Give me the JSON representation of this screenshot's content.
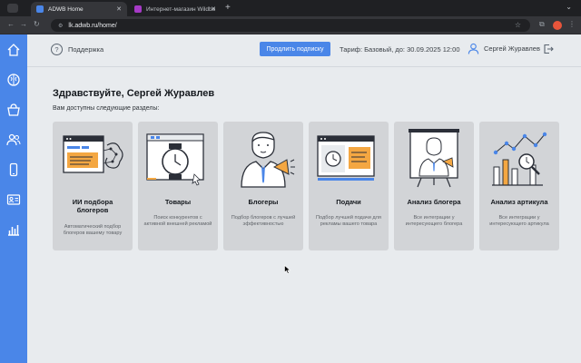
{
  "browser": {
    "tabs": [
      {
        "title": "ADWB Home",
        "active": true
      },
      {
        "title": "Интернет-магазин Wildber",
        "active": false
      }
    ],
    "url": "lk.adwb.ru/home/"
  },
  "sidebar": {
    "items": [
      {
        "icon": "home-icon"
      },
      {
        "icon": "brain-icon"
      },
      {
        "icon": "basket-icon"
      },
      {
        "icon": "users-icon"
      },
      {
        "icon": "phone-icon"
      },
      {
        "icon": "id-card-icon"
      },
      {
        "icon": "bar-chart-icon"
      }
    ]
  },
  "header": {
    "support_label": "Поддержка",
    "renew_label": "Продлить подписку",
    "tariff_text": "Тариф: Базовый, до: 30.09.2025 12:00",
    "user_name": "Сергей Журавлев"
  },
  "main": {
    "greeting": "Здравствуйте, Сергей Журавлев",
    "subtitle": "Вам доступны следующие разделы:",
    "cards": [
      {
        "title": "ИИ подбора блогеров",
        "desc": "Автоматический подбор блогеров вашему товару",
        "icon": "ai-brain-icon"
      },
      {
        "title": "Товары",
        "desc": "Поиск конкурентов с активной внешней рекламой",
        "icon": "watch-screen-icon"
      },
      {
        "title": "Блогеры",
        "desc": "Подбор блогеров с лучшей эффективностью",
        "icon": "blogger-icon"
      },
      {
        "title": "Подачи",
        "desc": "Подбор лучшей подачи для рекламы вашего товара",
        "icon": "ad-screen-icon"
      },
      {
        "title": "Анализ блогера",
        "desc": "Все интеграции у интересующего блогера",
        "icon": "presentation-icon"
      },
      {
        "title": "Анализ артикула",
        "desc": "Все интеграции у интересующего артикула",
        "icon": "analytics-icon"
      }
    ]
  },
  "colors": {
    "accent": "#4a86e8",
    "sidebar": "#4a86e8",
    "card": "#d2d4d7",
    "orange": "#f4a742",
    "background": "#e8ebee"
  }
}
